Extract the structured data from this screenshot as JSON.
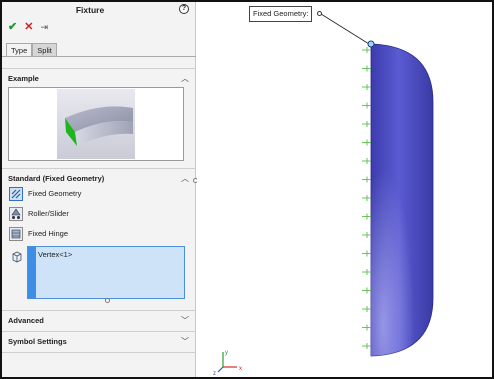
{
  "panel": {
    "title": "Fixture",
    "help_icon": "?",
    "ok_icon": "✔",
    "cancel_icon": "✕",
    "pin_icon": "⇥",
    "tabs": [
      {
        "label": "Type",
        "active": true
      },
      {
        "label": "Split",
        "active": false
      }
    ],
    "sections": {
      "example": {
        "label": "Example",
        "chevron": "︿"
      },
      "standard": {
        "label": "Standard (Fixed Geometry)",
        "chevron": "︿"
      },
      "advanced": {
        "label": "Advanced",
        "chevron": "﹀"
      },
      "symbol_settings": {
        "label": "Symbol Settings",
        "chevron": "﹀"
      }
    },
    "commands": [
      {
        "label": "Fixed Geometry",
        "icon": "fixed-geometry-icon",
        "selected": true
      },
      {
        "label": "Roller/Slider",
        "icon": "roller-slider-icon",
        "selected": false
      },
      {
        "label": "Fixed Hinge",
        "icon": "fixed-hinge-icon",
        "selected": false
      }
    ],
    "selection_list": {
      "icon": "vertex-selection-icon",
      "items": [
        "Vertex<1>"
      ]
    }
  },
  "viewport": {
    "callout_label": "Fixed Geometry:",
    "triad": {
      "x": "x",
      "y": "y",
      "z": "z"
    },
    "colors": {
      "part_body": "#5a5acb",
      "fixture_arrows": "#5dbb4a",
      "triad_x": "#d22b2b",
      "triad_y": "#2f9b2f",
      "triad_z": "#2f4fd2"
    }
  }
}
